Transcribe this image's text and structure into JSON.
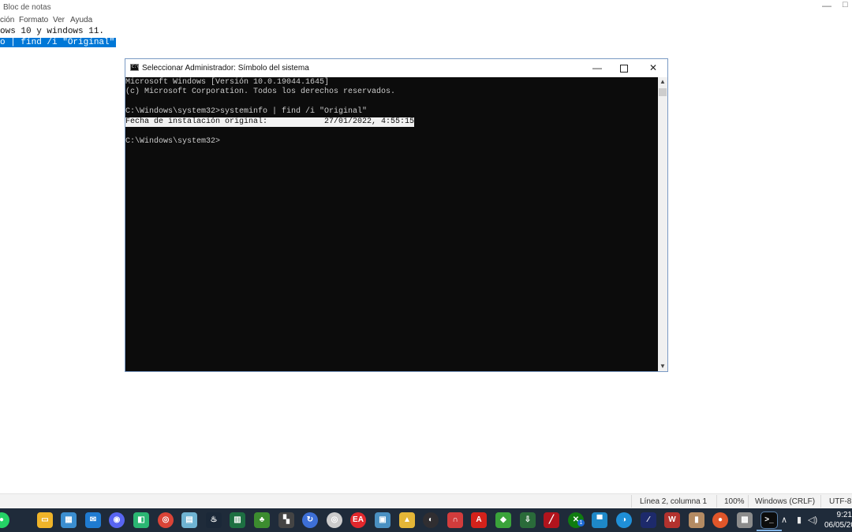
{
  "notepad": {
    "title": "Bloc de notas",
    "menu": [
      "ción",
      "Formato",
      "Ver",
      "Ayuda"
    ],
    "lines": [
      {
        "text": "ows 10 y windows 11.",
        "selected": false
      },
      {
        "text": "o | find /i \"Original\"",
        "selected": true
      }
    ],
    "status": {
      "position": "Línea 2, columna 1",
      "zoom": "100%",
      "line_endings": "Windows (CRLF)",
      "encoding": "UTF-8"
    }
  },
  "console": {
    "title": "Seleccionar Administrador: Símbolo del sistema",
    "icon_label": "C:\\",
    "lines": [
      {
        "text": "Microsoft Windows [Versión 10.0.19044.1645]",
        "selected": false
      },
      {
        "text": "(c) Microsoft Corporation. Todos los derechos reservados.",
        "selected": false
      },
      {
        "text": "",
        "selected": false
      },
      {
        "text": "C:\\Windows\\system32>systeminfo | find /i \"Original\"",
        "selected": false
      },
      {
        "text": "Fecha de instalación original:            27/01/2022, 4:55:15",
        "selected": true
      },
      {
        "text": "",
        "selected": false
      },
      {
        "text": "C:\\Windows\\system32>",
        "selected": false
      }
    ]
  },
  "taskbar": {
    "apps": [
      {
        "name": "whatsapp-icon",
        "color": "#25d366",
        "glyph": "●",
        "round": true
      },
      {
        "name": "file-explorer-icon",
        "color": "#f0b429",
        "glyph": "▭"
      },
      {
        "name": "microsoft-store-icon",
        "color": "#3b8ed0",
        "glyph": "▦"
      },
      {
        "name": "mail-icon",
        "color": "#1f7bd1",
        "glyph": "✉"
      },
      {
        "name": "discord-icon",
        "color": "#5865f2",
        "glyph": "◉",
        "round": true
      },
      {
        "name": "messenger-app-icon",
        "color": "#2bb673",
        "glyph": "◧"
      },
      {
        "name": "chrome-icon",
        "color": "#db4437",
        "glyph": "◎",
        "round": true
      },
      {
        "name": "notepad-plus-icon",
        "color": "#6fb3d2",
        "glyph": "▤"
      },
      {
        "name": "steam-icon",
        "color": "#1b2838",
        "glyph": "♨"
      },
      {
        "name": "excel-icon",
        "color": "#1d6f42",
        "glyph": "▥"
      },
      {
        "name": "plant-app-icon",
        "color": "#3c8c2f",
        "glyph": "♣"
      },
      {
        "name": "clapper-icon",
        "color": "#444444",
        "glyph": "▚"
      },
      {
        "name": "sync-app-icon",
        "color": "#3d6fd6",
        "glyph": "↻",
        "round": true
      },
      {
        "name": "ring-app-icon",
        "color": "#cccccc",
        "glyph": "◎",
        "round": true
      },
      {
        "name": "ea-icon",
        "color": "#e2282d",
        "glyph": "EA",
        "round": true
      },
      {
        "name": "image-viewer-icon",
        "color": "#4a90c2",
        "glyph": "▣"
      },
      {
        "name": "hat-app-icon",
        "color": "#e4b637",
        "glyph": "▲"
      },
      {
        "name": "obs-icon",
        "color": "#302e31",
        "glyph": "◐",
        "round": true
      },
      {
        "name": "magnet-app-icon",
        "color": "#d23c3c",
        "glyph": "∩"
      },
      {
        "name": "acrobat-icon",
        "color": "#d4221b",
        "glyph": "A"
      },
      {
        "name": "shield-icon",
        "color": "#3aa33a",
        "glyph": "◆"
      },
      {
        "name": "installer-icon",
        "color": "#2a6b3a",
        "glyph": "⇩"
      },
      {
        "name": "red-app-icon",
        "color": "#b1141d",
        "glyph": "╱"
      },
      {
        "name": "xbox-icon",
        "color": "#107c10",
        "glyph": "✕",
        "round": true,
        "badge": "1"
      },
      {
        "name": "window-app-icon",
        "color": "#1e88c8",
        "glyph": "▀"
      },
      {
        "name": "edge-icon",
        "color": "#1f8fd8",
        "glyph": "◑",
        "round": true
      },
      {
        "name": "pen-app-icon",
        "color": "#1d2a6b",
        "glyph": "∕"
      },
      {
        "name": "winrar-icon",
        "color": "#b3322e",
        "glyph": "W"
      },
      {
        "name": "archive-app-icon",
        "color": "#b48b63",
        "glyph": "▮"
      },
      {
        "name": "orange-app-icon",
        "color": "#e0562a",
        "glyph": "●",
        "round": true
      },
      {
        "name": "cpu-app-icon",
        "color": "#8c8c8c",
        "glyph": "▩"
      },
      {
        "name": "terminal-icon",
        "color": "#0c0c0c",
        "glyph": ">_",
        "active": true
      }
    ],
    "tray": {
      "chevron_glyph": "∧",
      "mic_glyph": "▮",
      "volume_glyph": "◁)",
      "time": "9:21",
      "date": "06/05/20"
    }
  }
}
